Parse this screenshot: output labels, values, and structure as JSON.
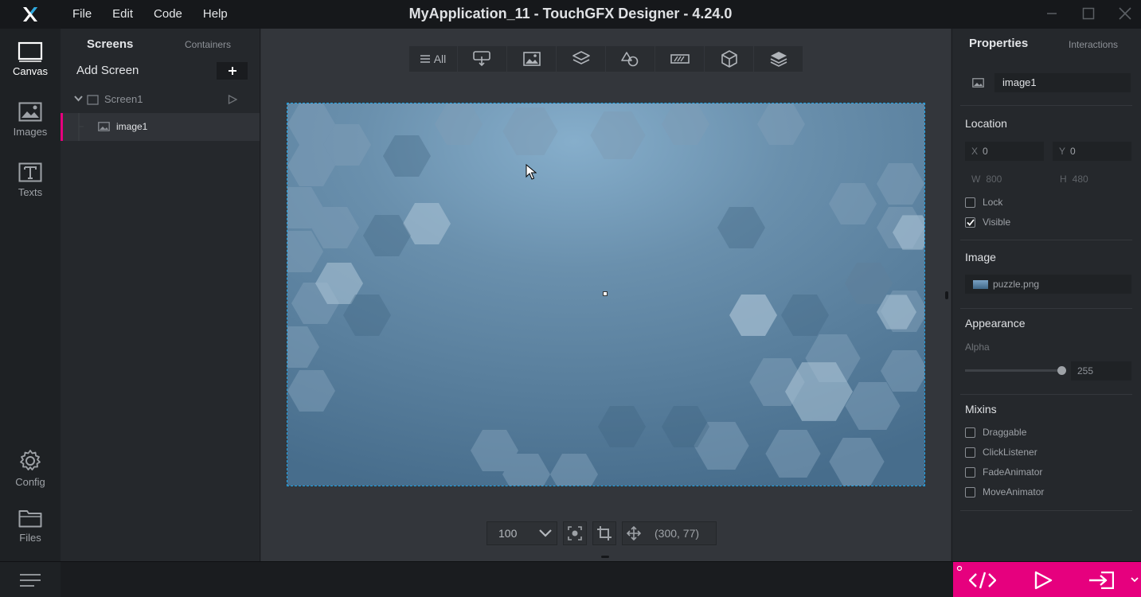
{
  "titlebar": {
    "title": "MyApplication_11 - TouchGFX Designer - 4.24.0",
    "menu": [
      "File",
      "Edit",
      "Code",
      "Help"
    ]
  },
  "leftnav": {
    "items": [
      {
        "label": "Canvas",
        "icon": "canvas-icon",
        "active": true
      },
      {
        "label": "Images",
        "icon": "images-icon",
        "active": false
      },
      {
        "label": "Texts",
        "icon": "texts-icon",
        "active": false
      },
      {
        "label": "Config",
        "icon": "gear-icon",
        "active": false
      },
      {
        "label": "Files",
        "icon": "folder-icon",
        "active": false
      }
    ]
  },
  "tree": {
    "tab_screens": "Screens",
    "tab_containers": "Containers",
    "add_screen": "Add Screen",
    "screen_name": "Screen1",
    "widget_name": "image1"
  },
  "toolbar": {
    "all_label": "All",
    "categories": [
      "interaction-icon",
      "image-icon",
      "container-icon",
      "shape-icon",
      "progress-icon",
      "3d-icon",
      "layers-icon"
    ]
  },
  "canvas_tools": {
    "zoom": "100",
    "cursor_coords": "(300, 77)"
  },
  "properties": {
    "tab_properties": "Properties",
    "tab_interactions": "Interactions",
    "name": "image1",
    "location_title": "Location",
    "x_label": "X",
    "x": "0",
    "y_label": "Y",
    "y": "0",
    "w_label": "W",
    "w": "800",
    "h_label": "H",
    "h": "480",
    "lock": "Lock",
    "visible": "Visible",
    "lock_checked": false,
    "visible_checked": true,
    "image_title": "Image",
    "image_file": "puzzle.png",
    "appearance_title": "Appearance",
    "alpha_label": "Alpha",
    "alpha": "255",
    "mixins_title": "Mixins",
    "mixins": [
      "Draggable",
      "ClickListener",
      "FadeAnimator",
      "MoveAnimator"
    ]
  },
  "colors": {
    "accent": "#e6007e",
    "selection": "#1ea3e6",
    "logo": "#29a8e0"
  }
}
